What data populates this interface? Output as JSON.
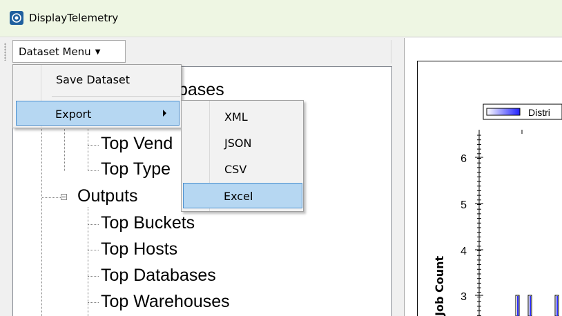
{
  "window": {
    "title": "DisplayTelemetry"
  },
  "toolbar": {
    "dataset_menu_label": "Dataset Menu"
  },
  "dataset_menu": {
    "items": [
      {
        "label": "Save Dataset"
      },
      {
        "label": "Export"
      }
    ]
  },
  "export_submenu": {
    "items": [
      {
        "label": "XML"
      },
      {
        "label": "JSON"
      },
      {
        "label": "CSV"
      },
      {
        "label": "Excel"
      }
    ]
  },
  "tree": {
    "partial_label": "bases",
    "inputs_children": [
      "Top Vend",
      "Top Type"
    ],
    "outputs_label": "Outputs",
    "outputs_children": [
      "Top Buckets",
      "Top Hosts",
      "Top Databases",
      "Top Warehouses"
    ]
  },
  "chart": {
    "legend_label": "Distri",
    "ylabel": "Job Count",
    "yticks": [
      "6",
      "5",
      "4",
      "3"
    ],
    "bar_color": "#3030ff"
  }
}
